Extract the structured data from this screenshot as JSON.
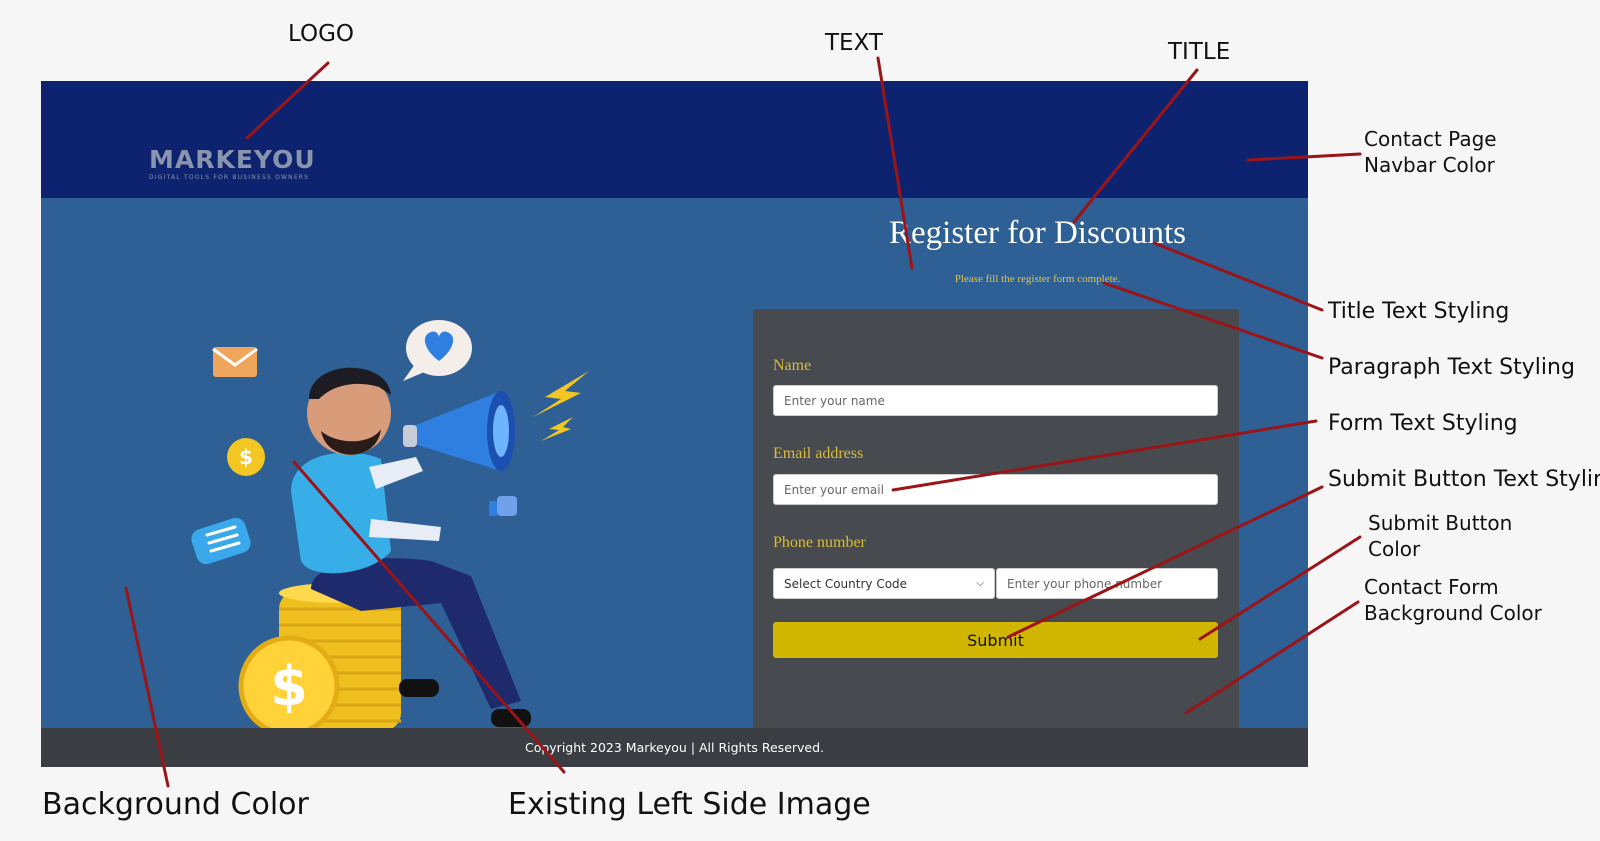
{
  "annotations": {
    "logo": "LOGO",
    "text": "TEXT",
    "title": "TITLE",
    "navbar_color": [
      "Contact Page",
      "Navbar Color"
    ],
    "title_styling": "Title Text Styling",
    "paragraph_styling": "Paragraph Text Styling",
    "form_styling": "Form Text Styling",
    "submit_text_styling": "Submit Button Text Styling",
    "submit_color": [
      "Submit Button",
      "Color"
    ],
    "form_bg_color": [
      "Contact Form",
      "Background Color"
    ],
    "background_color": "Background Color",
    "left_image": "Existing Left Side Image"
  },
  "page": {
    "logo": {
      "name": "MARKEYOU",
      "tagline": "DIGITAL TOOLS FOR BUSINESS OWNERS"
    },
    "title": "Register for Discounts",
    "subtitle": "Please fill the register form complete.",
    "form": {
      "name_label": "Name",
      "name_placeholder": "Enter your name",
      "email_label": "Email address",
      "email_placeholder": "Enter your email",
      "phone_label": "Phone number",
      "country_select_value": "Select Country Code",
      "phone_placeholder": "Enter your phone number",
      "submit_label": "Submit"
    },
    "footer": "Copyright 2023 Markeyou | All Rights Reserved."
  },
  "colors": {
    "navbar": "#0e2370",
    "background": "#2e6095",
    "form_background": "#474a4e",
    "submit_button": "#d0b600",
    "title_text": "#ffffff",
    "paragraph_text": "#e1c53d",
    "form_label_text": "#d8bc3a",
    "footer": "#3a3d41",
    "annotation_line": "#9b1418"
  },
  "icons": [
    "envelope-icon",
    "heart-chat-icon",
    "lightning-icon",
    "dollar-coin-icon",
    "thumbs-up-icon",
    "chat-bubble-icon",
    "megaphone-icon",
    "chevron-down-icon"
  ]
}
